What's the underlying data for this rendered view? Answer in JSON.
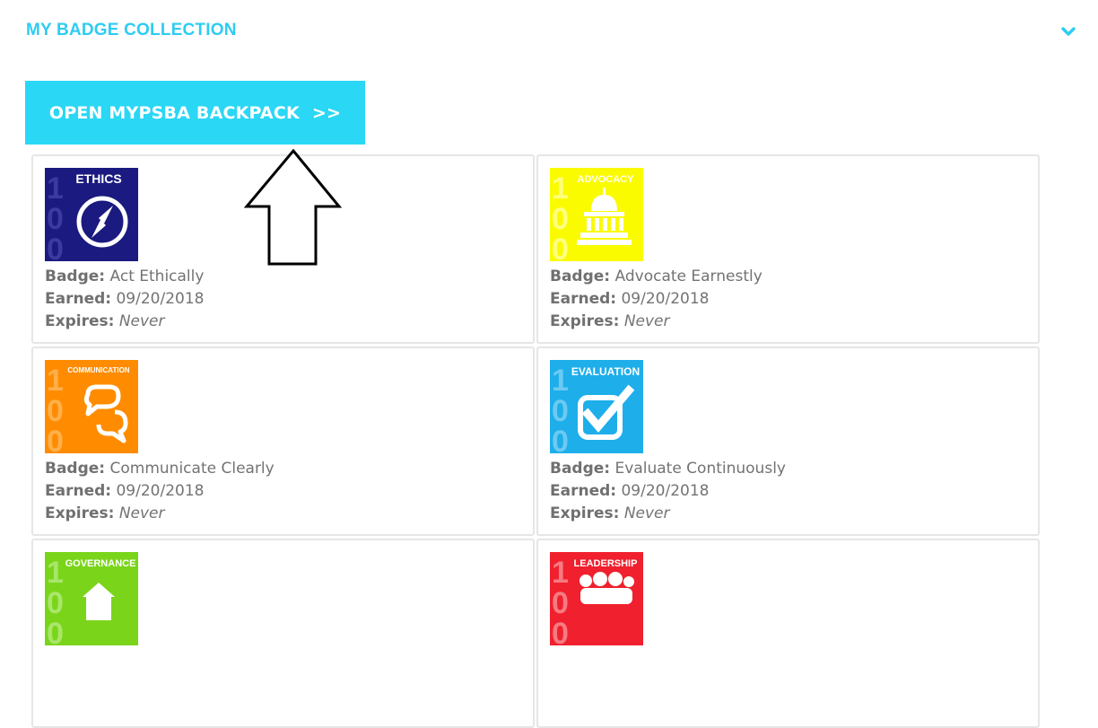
{
  "header": {
    "title": "MY BADGE COLLECTION",
    "title_color": "#2dccf2",
    "toggle_icon": "chevron-down-icon"
  },
  "backpack_button": {
    "label": "OPEN MYPSBA BACKPACK",
    "suffix": ">>",
    "bg_color": "#2ad7f5"
  },
  "labels": {
    "badge": "Badge:",
    "earned": "Earned:",
    "expires": "Expires:"
  },
  "badges": [
    {
      "category": "ETHICS",
      "name": "Act Ethically",
      "earned": "09/20/2018",
      "expires": "Never",
      "color": "#1a1a80",
      "numeral_color": "#3a3aa0",
      "icon": "compass-icon"
    },
    {
      "category": "ADVOCACY",
      "name": "Advocate Earnestly",
      "earned": "09/20/2018",
      "expires": "Never",
      "color": "#fbfb00",
      "numeral_color": "#ffff80",
      "icon": "capitol-dome-icon"
    },
    {
      "category": "COMMUNICATION",
      "name": "Communicate Clearly",
      "earned": "09/20/2018",
      "expires": "Never",
      "color": "#ff8c00",
      "numeral_color": "#ffb04a",
      "icon": "speech-bubbles-icon"
    },
    {
      "category": "EVALUATION",
      "name": "Evaluate Continuously",
      "earned": "09/20/2018",
      "expires": "Never",
      "color": "#1eaeea",
      "numeral_color": "#6ccaf2",
      "icon": "checkbox-icon"
    },
    {
      "category": "GOVERNANCE",
      "name": "",
      "earned": "",
      "expires": "",
      "color": "#7ad51a",
      "numeral_color": "#a9e66a",
      "icon": "house-icon"
    },
    {
      "category": "LEADERSHIP",
      "name": "",
      "earned": "",
      "expires": "",
      "color": "#f0202e",
      "numeral_color": "#f77a82",
      "icon": "people-group-icon"
    }
  ],
  "annotation": {
    "icon": "up-arrow-icon"
  }
}
